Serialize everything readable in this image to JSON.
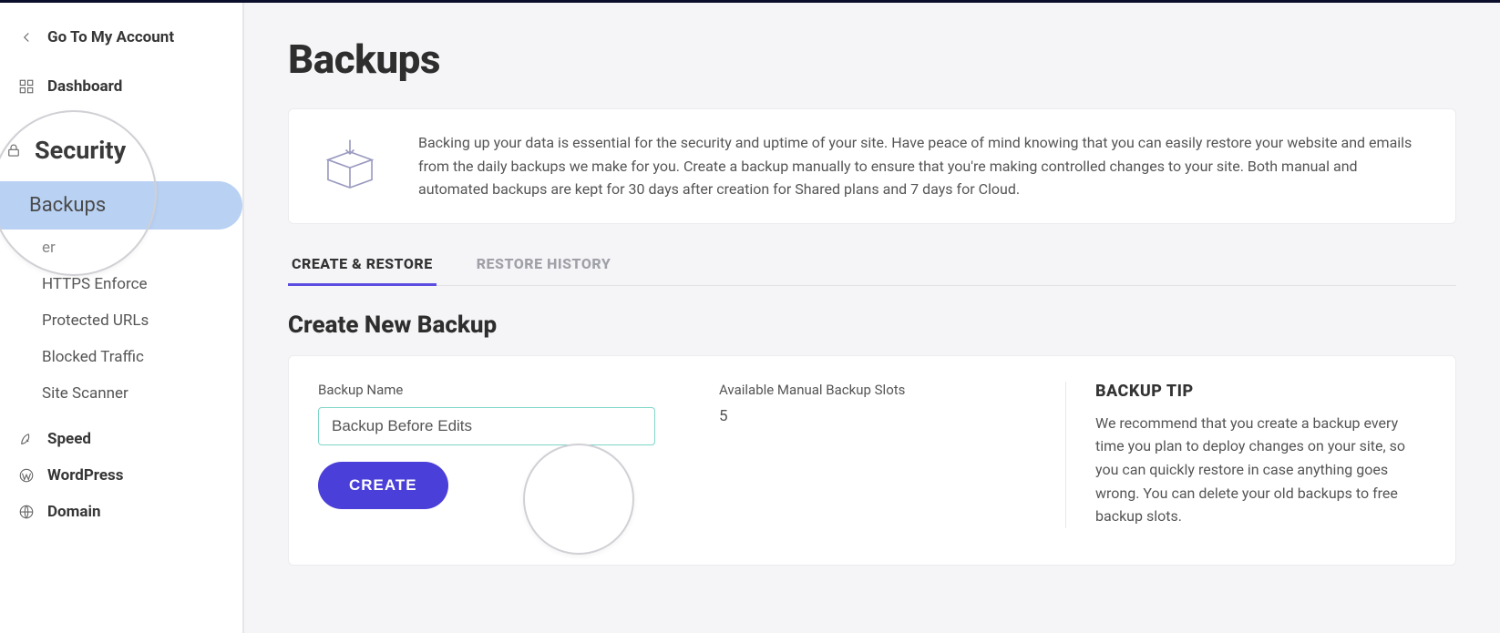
{
  "sidebar": {
    "go_to_account": "Go To My Account",
    "dashboard": "Dashboard",
    "security": "Security",
    "items": {
      "backups": "Backups",
      "truncated": "er",
      "https_enforce": "HTTPS Enforce",
      "protected_urls": "Protected URLs",
      "blocked_traffic": "Blocked Traffic",
      "site_scanner": "Site Scanner"
    },
    "speed": "Speed",
    "wordpress": "WordPress",
    "domain": "Domain"
  },
  "page": {
    "title": "Backups",
    "info_text": "Backing up your data is essential for the security and uptime of your site. Have peace of mind knowing that you can easily restore your website and emails from the daily backups we make for you. Create a backup manually to ensure that you're making controlled changes to your site. Both manual and automated backups are kept for 30 days after creation for Shared plans and 7 days for Cloud."
  },
  "tabs": {
    "create_restore": "CREATE & RESTORE",
    "restore_history": "RESTORE HISTORY"
  },
  "create": {
    "section_title": "Create New Backup",
    "name_label": "Backup Name",
    "name_value": "Backup Before Edits",
    "slots_label": "Available Manual Backup Slots",
    "slots_value": "5",
    "button": "CREATE"
  },
  "tip": {
    "title": "BACKUP TIP",
    "text": "We recommend that you create a backup every time you plan to deploy changes on your site, so you can quickly restore in case anything goes wrong. You can delete your old backups to free backup slots."
  }
}
